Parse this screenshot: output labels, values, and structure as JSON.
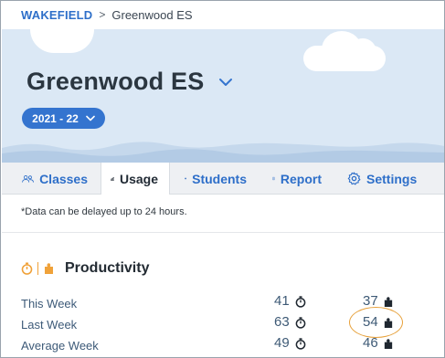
{
  "breadcrumb": {
    "root": "WAKEFIELD",
    "separator": ">",
    "current": "Greenwood ES"
  },
  "header": {
    "school_name": "Greenwood ES",
    "school_year": "2021 - 22"
  },
  "tabs": [
    {
      "label": "Classes",
      "icon": "users-icon"
    },
    {
      "label": "Usage",
      "icon": "bar-chart-icon",
      "active": true
    },
    {
      "label": "Students",
      "icon": "smiley-face-icon"
    },
    {
      "label": "Report",
      "icon": "report-icon"
    },
    {
      "label": "Settings",
      "icon": "gear-icon"
    }
  ],
  "note": "*Data can be delayed up to 24 hours.",
  "productivity": {
    "title": "Productivity",
    "rows": [
      {
        "label": "This Week",
        "time": "41",
        "pieces": "37"
      },
      {
        "label": "Last Week",
        "time": "63",
        "pieces": "54"
      },
      {
        "label": "Average Week",
        "time": "49",
        "pieces": "46"
      }
    ]
  },
  "colors": {
    "accent": "#3474cf",
    "link": "#2e6fc9",
    "highlight": "#e7a13b",
    "icon_orange": "#f0a23a",
    "hero_bg": "#dbe8f5"
  }
}
